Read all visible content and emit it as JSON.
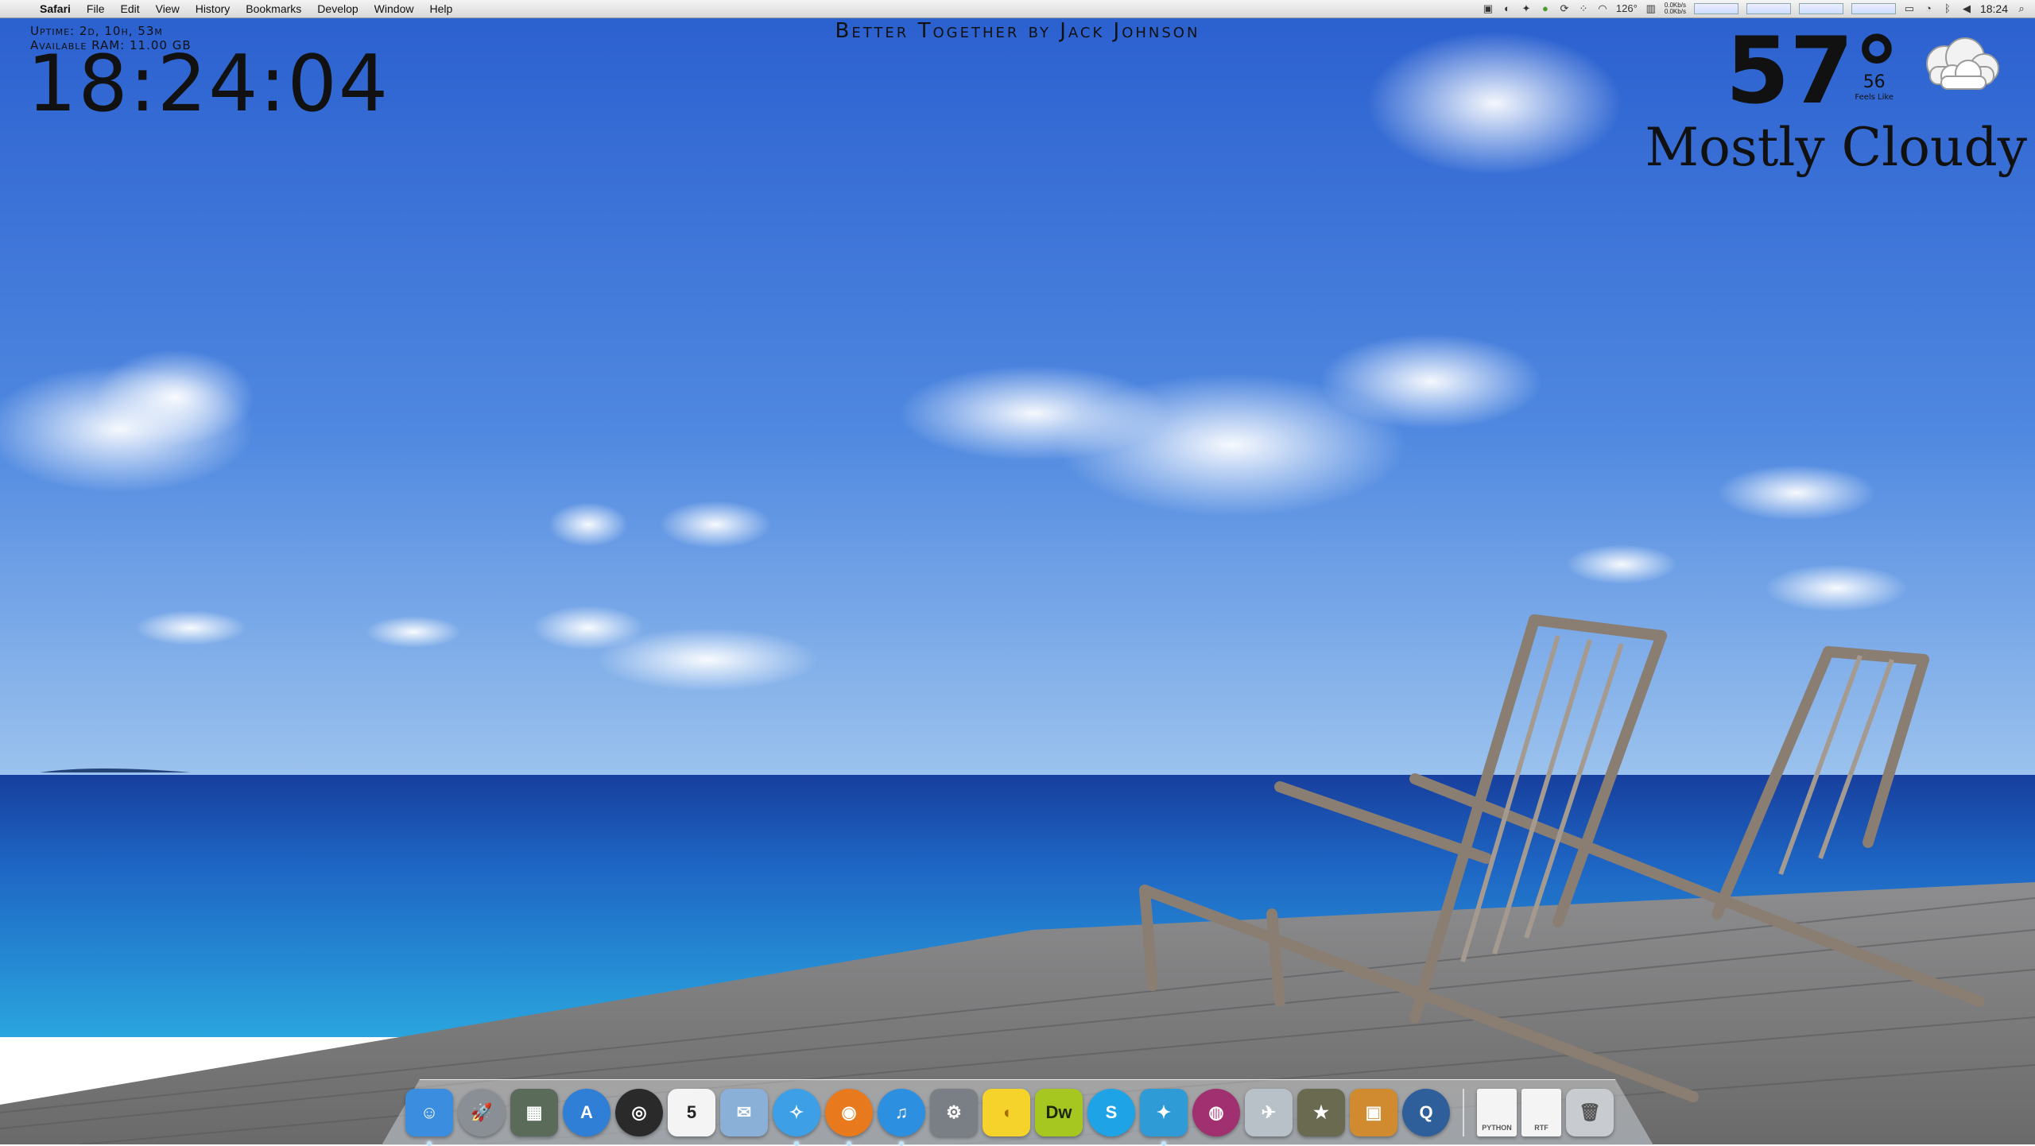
{
  "menubar": {
    "app_name": "Safari",
    "items": [
      "File",
      "Edit",
      "View",
      "History",
      "Bookmarks",
      "Develop",
      "Window",
      "Help"
    ],
    "tray": {
      "temperature": "126°",
      "net_up": "0.0Kb/s",
      "net_down": "0.0Kb/s",
      "clock": "18:24"
    }
  },
  "widgets": {
    "uptime": "Uptime: 2d, 10h, 53m",
    "ram": "Available RAM: 11.00 GB",
    "clock": "18:24:04",
    "now_playing": "Better Together by Jack Johnson",
    "weather": {
      "temp": "57°",
      "feels_like": "56",
      "feels_label": "Feels Like",
      "condition": "Mostly Cloudy"
    }
  },
  "dock": {
    "apps": [
      {
        "name": "Finder",
        "icon": "finder-icon",
        "color": "#3b8de0",
        "glyph": "☺",
        "running": true
      },
      {
        "name": "Launchpad",
        "icon": "launchpad-icon",
        "color": "#8a8f96",
        "glyph": "🚀",
        "round": true
      },
      {
        "name": "Image Capture",
        "icon": "image-capture-icon",
        "color": "#5a6b5a",
        "glyph": "▦"
      },
      {
        "name": "App Store",
        "icon": "app-store-icon",
        "color": "#2f7fd6",
        "glyph": "A",
        "round": true
      },
      {
        "name": "Dashboard",
        "icon": "dashboard-icon",
        "color": "#2a2a2a",
        "glyph": "◎",
        "round": true
      },
      {
        "name": "Calendar",
        "icon": "calendar-icon",
        "color": "#f4f4f4",
        "glyph": "5",
        "text": "#222"
      },
      {
        "name": "Mail",
        "icon": "mail-icon",
        "color": "#8ab0d8",
        "glyph": "✉"
      },
      {
        "name": "Safari",
        "icon": "safari-icon",
        "color": "#3da0e6",
        "glyph": "✧",
        "round": true,
        "running": true
      },
      {
        "name": "Firefox",
        "icon": "firefox-icon",
        "color": "#e8791c",
        "glyph": "◉",
        "round": true,
        "running": true
      },
      {
        "name": "iTunes",
        "icon": "itunes-icon",
        "color": "#2c8fe0",
        "glyph": "♫",
        "round": true,
        "running": true
      },
      {
        "name": "System Preferences",
        "icon": "system-preferences-icon",
        "color": "#7a7f86",
        "glyph": "⚙"
      },
      {
        "name": "Cyberduck",
        "icon": "cyberduck-icon",
        "color": "#f6d32a",
        "glyph": "◖",
        "text": "#a66d00"
      },
      {
        "name": "Dreamweaver",
        "icon": "dreamweaver-icon",
        "color": "#a6c620",
        "glyph": "Dw",
        "text": "#1b2a05"
      },
      {
        "name": "Skype",
        "icon": "skype-icon",
        "color": "#1ea3e6",
        "glyph": "S",
        "round": true
      },
      {
        "name": "Twitter",
        "icon": "twitter-icon",
        "color": "#2e9ad6",
        "glyph": "✦",
        "running": true
      },
      {
        "name": "Adium",
        "icon": "adium-icon",
        "color": "#a03070",
        "glyph": "◍",
        "round": true
      },
      {
        "name": "Automator",
        "icon": "automator-icon",
        "color": "#b8c0c8",
        "glyph": "✈"
      },
      {
        "name": "iMovie",
        "icon": "imovie-icon",
        "color": "#6a6a50",
        "glyph": "★"
      },
      {
        "name": "Image Viewer",
        "icon": "photo-viewer-icon",
        "color": "#d08a30",
        "glyph": "▣"
      },
      {
        "name": "QuickTime",
        "icon": "quicktime-icon",
        "color": "#2f5f9a",
        "glyph": "Q",
        "round": true
      }
    ],
    "docs": [
      {
        "label": "PYTHON",
        "icon": "python-document-icon"
      },
      {
        "label": "RTF",
        "icon": "rtf-document-icon"
      }
    ],
    "trash_icon": "trash-icon"
  }
}
